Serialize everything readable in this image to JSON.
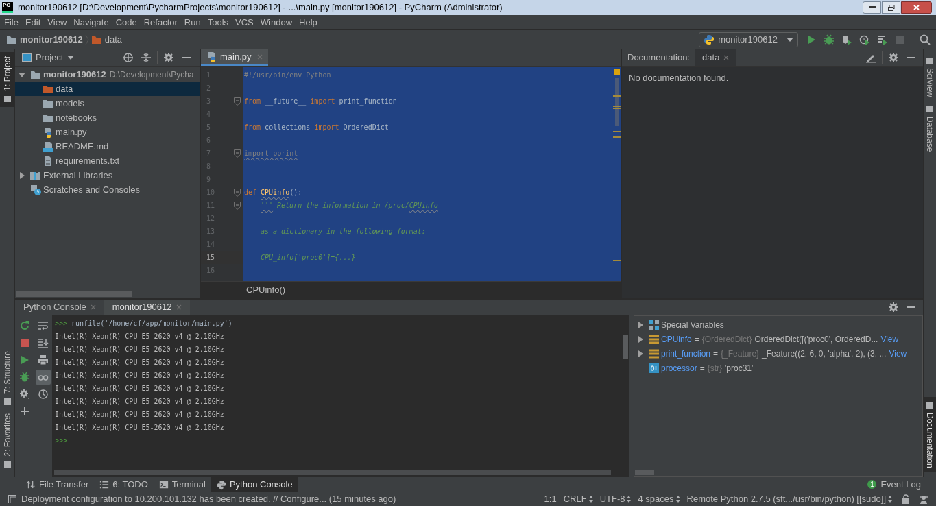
{
  "window": {
    "logo_text": "PC",
    "title": "monitor190612 [D:\\Development\\PycharmProjects\\monitor190612] - ...\\main.py [monitor190612] - PyCharm (Administrator)"
  },
  "menu": [
    "File",
    "Edit",
    "View",
    "Navigate",
    "Code",
    "Refactor",
    "Run",
    "Tools",
    "VCS",
    "Window",
    "Help"
  ],
  "breadcrumb": [
    {
      "label": "monitor190612",
      "kind": "project"
    },
    {
      "label": "data",
      "kind": "folder_marked"
    }
  ],
  "run_config": {
    "label": "monitor190612"
  },
  "left_stripe": {
    "top": [
      {
        "label": "1: Project",
        "selected": true
      }
    ],
    "bottom": [
      {
        "label": "7: Structure",
        "selected": false
      },
      {
        "label": "2: Favorites",
        "selected": false
      }
    ]
  },
  "project_panel": {
    "title": "Project",
    "tree": [
      {
        "label": "monitor190612",
        "path": "D:\\Development\\Pycha",
        "kind": "project",
        "expanded": true,
        "selected": false,
        "children": [
          {
            "label": "data",
            "kind": "folder_marked",
            "selected": true
          },
          {
            "label": "models",
            "kind": "folder",
            "selected": false
          },
          {
            "label": "notebooks",
            "kind": "folder",
            "selected": false
          },
          {
            "label": "main.py",
            "kind": "python",
            "selected": false
          },
          {
            "label": "README.md",
            "kind": "markdown",
            "selected": false
          },
          {
            "label": "requirements.txt",
            "kind": "text",
            "selected": false
          }
        ]
      },
      {
        "label": "External Libraries",
        "kind": "libraries",
        "expanded": false,
        "selected": false
      },
      {
        "label": "Scratches and Consoles",
        "kind": "scratches",
        "selected": false
      }
    ]
  },
  "editor": {
    "tabs": [
      {
        "label": "main.py",
        "selected": true
      }
    ],
    "lines": [
      {
        "number": "1",
        "current": false,
        "tokens": [
          {
            "text": "#!/usr/bin/env Python",
            "kind": "comment"
          }
        ]
      },
      {
        "number": "2",
        "current": false
      },
      {
        "number": "3",
        "current": false,
        "fold": true,
        "tokens": [
          {
            "text": "from",
            "kind": "keyword"
          },
          {
            "text": " __future__ ",
            "kind": "plain"
          },
          {
            "text": "import",
            "kind": "keyword"
          },
          {
            "text": " print_function",
            "kind": "plain"
          }
        ]
      },
      {
        "number": "4",
        "current": false
      },
      {
        "number": "5",
        "current": false,
        "tokens": [
          {
            "text": "from",
            "kind": "keyword"
          },
          {
            "text": " collections ",
            "kind": "plain"
          },
          {
            "text": "import",
            "kind": "keyword"
          },
          {
            "text": " OrderedDict",
            "kind": "plain"
          }
        ]
      },
      {
        "number": "6",
        "current": false
      },
      {
        "number": "7",
        "current": false,
        "fold": true,
        "tokens": [
          {
            "text": "import pprint",
            "kind": "unused",
            "squiggle": true
          }
        ]
      },
      {
        "number": "8",
        "current": false
      },
      {
        "number": "9",
        "current": false
      },
      {
        "number": "10",
        "current": false,
        "fold": true,
        "tokens": [
          {
            "text": "def",
            "kind": "keyword"
          },
          {
            "text": "CPUinfo",
            "kind": "function",
            "squiggle": true,
            "space_before": true
          },
          {
            "text": "():",
            "kind": "plain"
          }
        ]
      },
      {
        "number": "11",
        "current": false,
        "fold": true,
        "indented": true,
        "tokens": [
          {
            "text": "'''",
            "kind": "docstring",
            "squiggle": true
          },
          {
            "text": "Return the information in /proc/",
            "kind": "docstring",
            "space_before": true
          },
          {
            "text": "CPUinfo",
            "kind": "docstring",
            "squiggle": true
          }
        ]
      },
      {
        "number": "12",
        "current": false
      },
      {
        "number": "13",
        "current": false,
        "indented": true,
        "tokens": [
          {
            "text": "as a dictionary in the following format:",
            "kind": "docstring"
          }
        ]
      },
      {
        "number": "14",
        "current": false
      },
      {
        "number": "15",
        "current": true,
        "indented": true,
        "tokens": [
          {
            "text": "CPU_info['proc0']={...}",
            "kind": "docstring"
          }
        ]
      },
      {
        "number": "16",
        "current": false
      }
    ],
    "breadcrumb": "CPUinfo()"
  },
  "documentation": {
    "label": "Documentation:",
    "tabs": [
      {
        "label": "data",
        "selected": true
      }
    ],
    "message": "No documentation found."
  },
  "right_stripe": {
    "top": [
      {
        "label": "SciView",
        "selected": false
      },
      {
        "label": "Database",
        "selected": false
      }
    ],
    "bottom": [
      {
        "label": "Documentation",
        "selected": true
      }
    ]
  },
  "console": {
    "tabs": [
      {
        "label": "Python Console",
        "selected": false
      },
      {
        "label": "monitor190612",
        "selected": true
      }
    ],
    "lines": [
      {
        "kind": "input",
        "prompt": ">>>",
        "text": "runfile('/home/cf/app/monitor/main.py')"
      },
      {
        "kind": "output",
        "text": "Intel(R) Xeon(R) CPU E5-2620 v4 @ 2.10GHz"
      },
      {
        "kind": "output",
        "text": "Intel(R) Xeon(R) CPU E5-2620 v4 @ 2.10GHz"
      },
      {
        "kind": "output",
        "text": "Intel(R) Xeon(R) CPU E5-2620 v4 @ 2.10GHz"
      },
      {
        "kind": "output",
        "text": "Intel(R) Xeon(R) CPU E5-2620 v4 @ 2.10GHz"
      },
      {
        "kind": "output",
        "text": "Intel(R) Xeon(R) CPU E5-2620 v4 @ 2.10GHz"
      },
      {
        "kind": "output",
        "text": "Intel(R) Xeon(R) CPU E5-2620 v4 @ 2.10GHz"
      },
      {
        "kind": "output",
        "text": "Intel(R) Xeon(R) CPU E5-2620 v4 @ 2.10GHz"
      },
      {
        "kind": "output",
        "text": "Intel(R) Xeon(R) CPU E5-2620 v4 @ 2.10GHz"
      },
      {
        "kind": "input",
        "prompt": ">>>"
      }
    ],
    "variables": [
      {
        "kind": "group",
        "name": "Special Variables",
        "expanded": false
      },
      {
        "kind": "dict",
        "name": "CPUinfo",
        "sep": "=",
        "type": "{OrderedDict}",
        "value": "OrderedDict([('proc0', OrderedD...",
        "link": "View",
        "expanded": false
      },
      {
        "kind": "dict",
        "name": "print_function",
        "sep": "=",
        "type": "{_Feature}",
        "value": "_Feature((2, 6, 0, 'alpha', 2), (3, ...",
        "link": "View",
        "expanded": false
      },
      {
        "kind": "str",
        "name": "processor",
        "sep": "=",
        "type": "{str}",
        "value": "'proc31'"
      }
    ]
  },
  "tool_windows": [
    {
      "label": "File Transfer",
      "kind": "transfer",
      "selected": false
    },
    {
      "label": "6: TODO",
      "kind": "todo",
      "selected": false
    },
    {
      "label": "Terminal",
      "kind": "terminal",
      "selected": false
    },
    {
      "label": "Python Console",
      "kind": "python",
      "selected": true
    }
  ],
  "event_log": {
    "count": "1",
    "label": "Event Log"
  },
  "status_bar": {
    "message": "Deployment configuration to 10.200.101.132 has been created. // Configure... (15 minutes ago)",
    "items": [
      {
        "label": "1:1"
      },
      {
        "label": "CRLF",
        "dropdown": true
      },
      {
        "label": "UTF-8",
        "dropdown": true
      },
      {
        "label": "4 spaces",
        "dropdown": true
      },
      {
        "label": "Remote Python 2.7.5 (sft.../usr/bin/python) [[sudo]]",
        "dropdown": true
      }
    ]
  }
}
